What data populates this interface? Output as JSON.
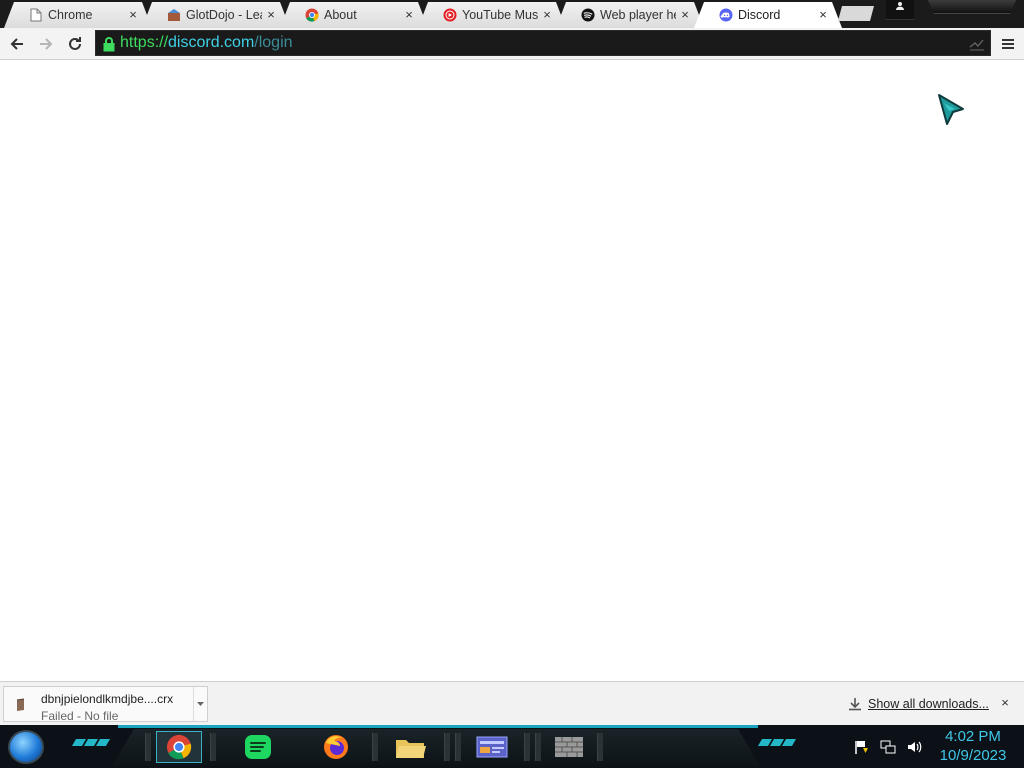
{
  "browser": {
    "tabs": [
      {
        "title": "Chrome",
        "icon": "page-icon",
        "active": false
      },
      {
        "title": "GlotDojo - Lear",
        "icon": "glotdojo-icon",
        "active": false
      },
      {
        "title": "About",
        "icon": "chrome-icon",
        "active": false
      },
      {
        "title": "YouTube Music",
        "icon": "youtube-music-icon",
        "active": false
      },
      {
        "title": "Web player hel",
        "icon": "spotify-icon",
        "active": false
      },
      {
        "title": "Discord",
        "icon": "discord-icon",
        "active": true
      }
    ],
    "close_glyph": "×",
    "url": {
      "scheme": "https://",
      "host": "discord.com",
      "path": "/login"
    }
  },
  "downloads": {
    "item": {
      "filename": "dbnjpielondlkmdjbe....crx",
      "status": "Failed - No file"
    },
    "show_all_label": "Show all downloads...",
    "close_glyph": "×"
  },
  "taskbar": {
    "time": "4:02 PM",
    "date": "10/9/2023",
    "apps": [
      "chrome-icon",
      "spotify-icon",
      "firefox-icon",
      "file-explorer-icon",
      "control-panel-icon",
      "firewall-icon"
    ]
  },
  "colors": {
    "url_scheme": "#3ddc5f",
    "url_host": "#3fd0e6",
    "url_path": "#3b8c98",
    "clock": "#3fc6e8",
    "taskbar_accent": "#19a5c0"
  }
}
